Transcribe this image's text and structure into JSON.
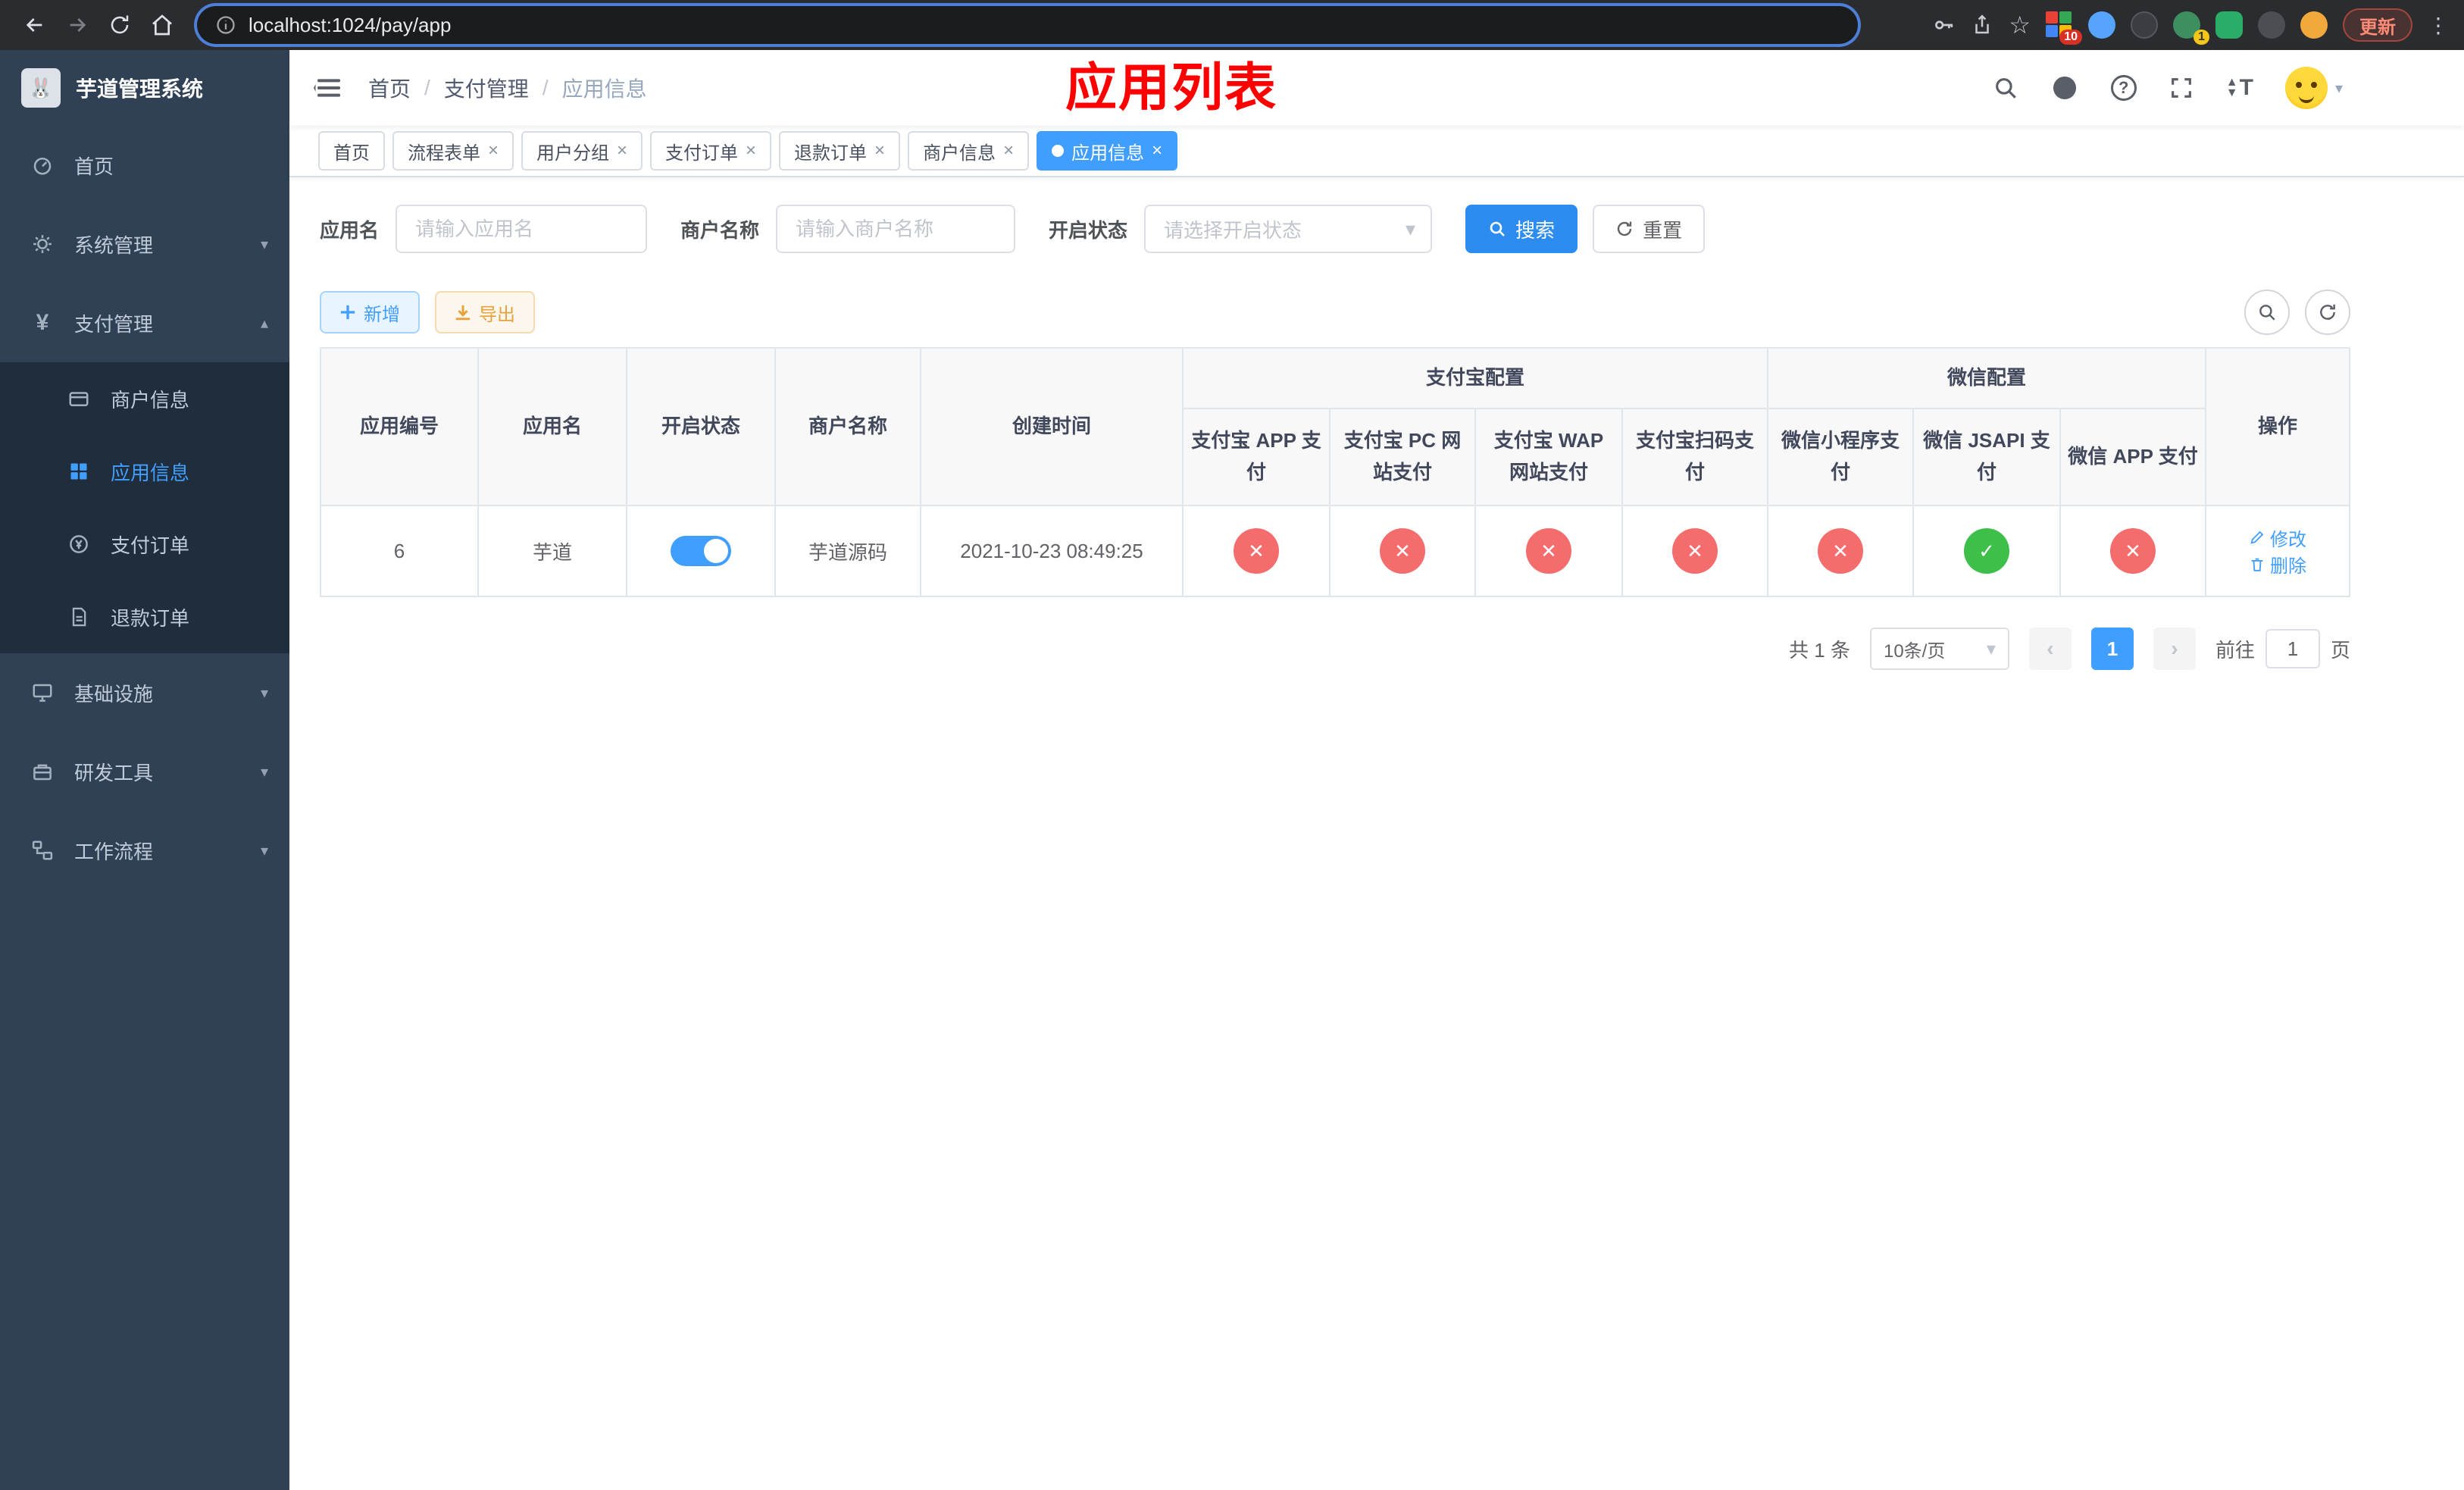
{
  "icons": {
    "close": "×",
    "chevron_down": "▾",
    "chevron_up": "▴",
    "kebab": "⋮",
    "star": "☆",
    "prev": "‹",
    "next": "›",
    "caret": "▾",
    "question": "?"
  },
  "browser": {
    "url": "localhost:1024/pay/app",
    "update_label": "更新",
    "extensions_badge": "10",
    "avatar_badge": "1"
  },
  "sidebar": {
    "title": "芋道管理系统",
    "items": {
      "home": "首页",
      "system": "系统管理",
      "payment": "支付管理",
      "infra": "基础设施",
      "devtools": "研发工具",
      "workflow": "工作流程"
    },
    "payment_children": {
      "merchant": "商户信息",
      "app": "应用信息",
      "order": "支付订单",
      "refund": "退款订单"
    }
  },
  "topbar": {
    "breadcrumb": {
      "home": "首页",
      "section": "支付管理",
      "current": "应用信息"
    },
    "banner": "应用列表"
  },
  "tabs": [
    {
      "label": "首页"
    },
    {
      "label": "流程表单"
    },
    {
      "label": "用户分组"
    },
    {
      "label": "支付订单"
    },
    {
      "label": "退款订单"
    },
    {
      "label": "商户信息"
    },
    {
      "label": "应用信息"
    }
  ],
  "filters": {
    "app_name_label": "应用名",
    "app_name_placeholder": "请输入应用名",
    "merchant_label": "商户名称",
    "merchant_placeholder": "请输入商户名称",
    "status_label": "开启状态",
    "status_placeholder": "请选择开启状态",
    "search_label": "搜索",
    "reset_label": "重置"
  },
  "toolbar": {
    "add_label": "新增",
    "export_label": "导出"
  },
  "table": {
    "headers": {
      "id": "应用编号",
      "name": "应用名",
      "status": "开启状态",
      "merchant": "商户名称",
      "created": "创建时间",
      "alipay_group": "支付宝配置",
      "wechat_group": "微信配置",
      "alipay_app": "支付宝 APP 支付",
      "alipay_pc": "支付宝 PC 网站支付",
      "alipay_wap": "支付宝 WAP 网站支付",
      "alipay_qr": "支付宝扫码支付",
      "wx_mini": "微信小程序支付",
      "wx_jsapi": "微信 JSAPI 支付",
      "wx_app": "微信 APP 支付",
      "actions": "操作"
    },
    "row": {
      "id": "6",
      "name": "芋道",
      "enabled": true,
      "merchant": "芋道源码",
      "created": "2021-10-23 08:49:25",
      "alipay_app": false,
      "alipay_pc": false,
      "alipay_wap": false,
      "alipay_qr": false,
      "wx_mini": false,
      "wx_jsapi": true,
      "wx_app": false,
      "edit_label": "修改",
      "delete_label": "删除"
    }
  },
  "pagination": {
    "total": "共 1 条",
    "page_size": "10条/页",
    "page": "1",
    "goto_prefix": "前往",
    "goto_value": "1",
    "goto_suffix": "页"
  }
}
